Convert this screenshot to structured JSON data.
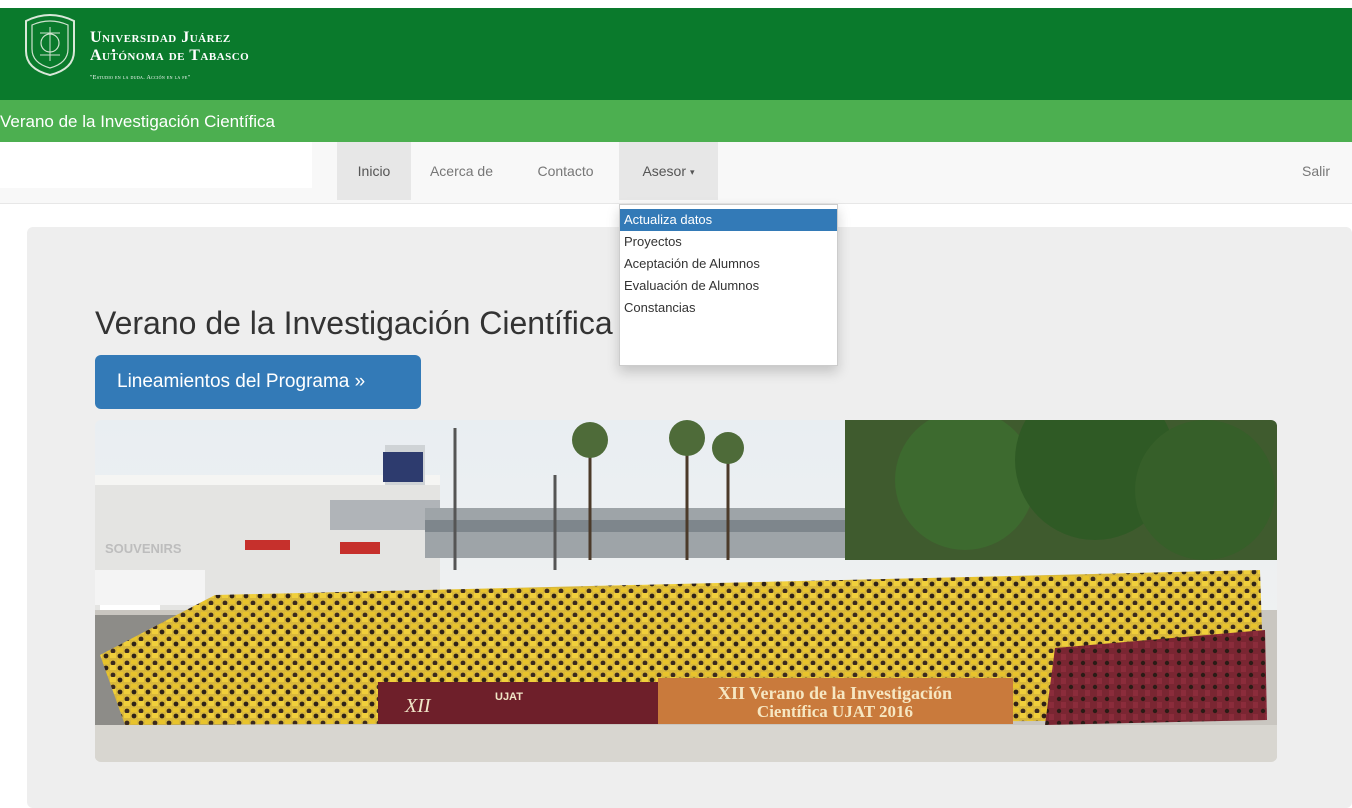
{
  "header": {
    "logo_line1": "Universidad Juárez",
    "logo_line2": "Autónoma de Tabasco",
    "logo_motto": "\"Estudio en la duda. Acción en la fe\"",
    "brand_color": "#0a7a2c"
  },
  "subbar": {
    "title": "Verano de la Investigación Científica",
    "color": "#4caf50"
  },
  "nav": {
    "items": [
      {
        "label": "Inicio",
        "active": true
      },
      {
        "label": "Acerca de"
      },
      {
        "label": "Contacto"
      },
      {
        "label": "Asesor",
        "has_dropdown": true,
        "open": true
      }
    ],
    "right": "Salir",
    "caret_icon": "caret-down-icon"
  },
  "dropdown": {
    "items": [
      {
        "label": "Actualiza datos",
        "highlighted": true
      },
      {
        "label": "Proyectos"
      },
      {
        "label": "Aceptación de Alumnos"
      },
      {
        "label": "Evaluación de Alumnos"
      },
      {
        "label": "Constancias"
      }
    ]
  },
  "main": {
    "title": "Verano de la Investigación Científica",
    "button_label": "Lineamientos del Programa »",
    "accent_color": "#337ab7"
  },
  "photo": {
    "banner_left": "XII",
    "banner_logo": "UJAT",
    "banner_title_line1": "XII Verano de la Investigación",
    "banner_title_line2": "Científica UJAT 2016",
    "sign_left": "SOUVENIRS"
  }
}
